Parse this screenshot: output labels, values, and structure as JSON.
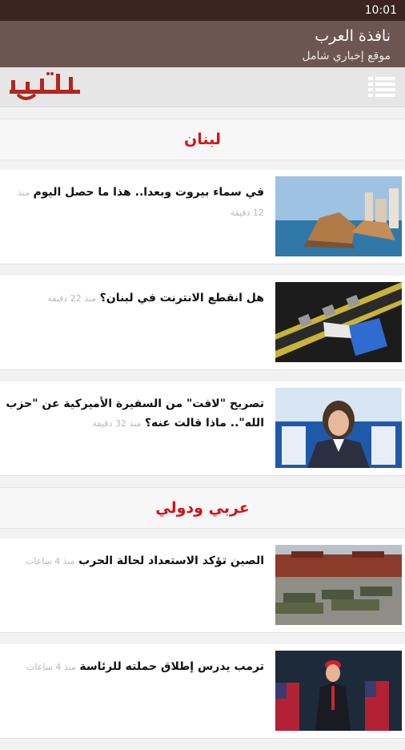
{
  "status": {
    "time": "10:01"
  },
  "app": {
    "title": "نافذة العرب",
    "subtitle": "موقع إخباري شامل",
    "logo_text": "نافذة العرب"
  },
  "icons": {
    "menu": "menu-list-icon"
  },
  "colors": {
    "status_bar": "#3b2520",
    "app_bar": "#6d5551",
    "section_title": "#d2121a",
    "logo": "#b3261e"
  },
  "sections": [
    {
      "title": "لبنان",
      "articles": [
        {
          "headline": "في سماء بيروت وبعدا.. هذا ما حصل اليوم",
          "time": "منذ 12 دقيقة"
        },
        {
          "headline": "هل انقطع الانترنت في لبنان؟",
          "time": "منذ 22 دقيقة"
        },
        {
          "headline": "تصريح \"لافت\" من السفيرة الأميركية عن \"حزب الله\".. ماذا قالت عنه؟",
          "time": "منذ 32 دقيقة"
        }
      ]
    },
    {
      "title": "عربي ودولي",
      "articles": [
        {
          "headline": "الصين تؤكد الاستعداد لحالة الحرب",
          "time": "منذ 4 ساعات"
        },
        {
          "headline": "ترمب يدرس إطلاق حملته للرئاسة",
          "time": "منذ 4 ساعات"
        }
      ]
    }
  ]
}
